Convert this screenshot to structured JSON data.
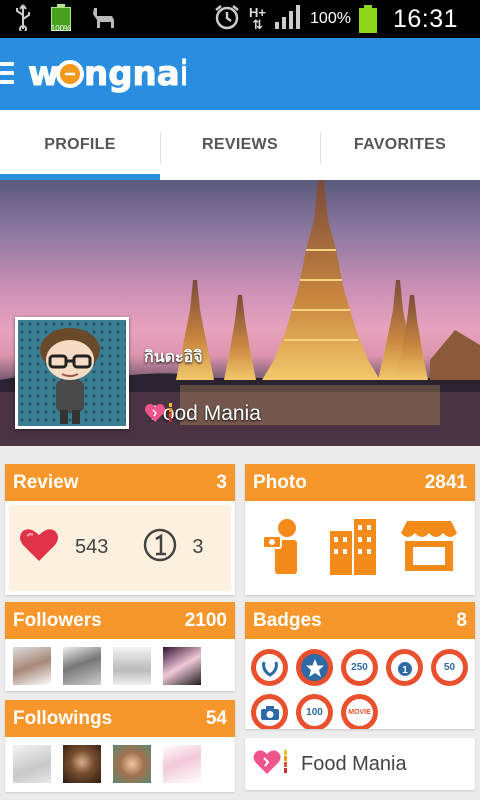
{
  "status_bar": {
    "battery_small_label": "100%",
    "network_type": "H+",
    "battery_percent": "100%",
    "clock": "16:31"
  },
  "app_bar": {
    "logo_text": "wongnai"
  },
  "tabs": [
    {
      "label": "PROFILE",
      "active": true
    },
    {
      "label": "REVIEWS",
      "active": false
    },
    {
      "label": "FAVORITES",
      "active": false
    }
  ],
  "profile": {
    "name": "กินดะอิจิ",
    "rank": "Food Mania",
    "rank_icon": "heart-rank-icon"
  },
  "review_card": {
    "title": "Review",
    "count": "3",
    "likes": "543",
    "first_reviews": "3",
    "like_icon": "heart-icon",
    "first_icon": "number-one-icon"
  },
  "photo_card": {
    "title": "Photo",
    "count": "2841",
    "icons": [
      "photographer-icon",
      "building-icon",
      "shop-icon"
    ]
  },
  "followers_card": {
    "title": "Followers",
    "count": "2100",
    "thumb_count_shown": 4
  },
  "badges_card": {
    "title": "Badges",
    "count": "8",
    "items": [
      {
        "icon": "laurel-badge-icon",
        "text": ""
      },
      {
        "icon": "star-badge-icon",
        "text": ""
      },
      {
        "icon": "count-badge-icon",
        "text": "250"
      },
      {
        "icon": "medal-badge-icon",
        "text": ""
      },
      {
        "icon": "count-badge-icon",
        "text": "50"
      },
      {
        "icon": "camera-badge-icon",
        "text": ""
      },
      {
        "icon": "count-badge-icon",
        "text": "100"
      },
      {
        "icon": "movie-badge-icon",
        "text": "MOVIE"
      }
    ]
  },
  "followings_card": {
    "title": "Followings",
    "count": "54"
  },
  "rank_card": {
    "label": "Food Mania",
    "icon": "heart-rank-icon"
  },
  "colors": {
    "brand_blue": "#2a8ee0",
    "card_orange": "#f7962b",
    "badge_red": "#e9502e",
    "photo_icon_orange": "#f38a1a",
    "heart_red": "#e0334a",
    "heart_pink": "#f0548c"
  }
}
